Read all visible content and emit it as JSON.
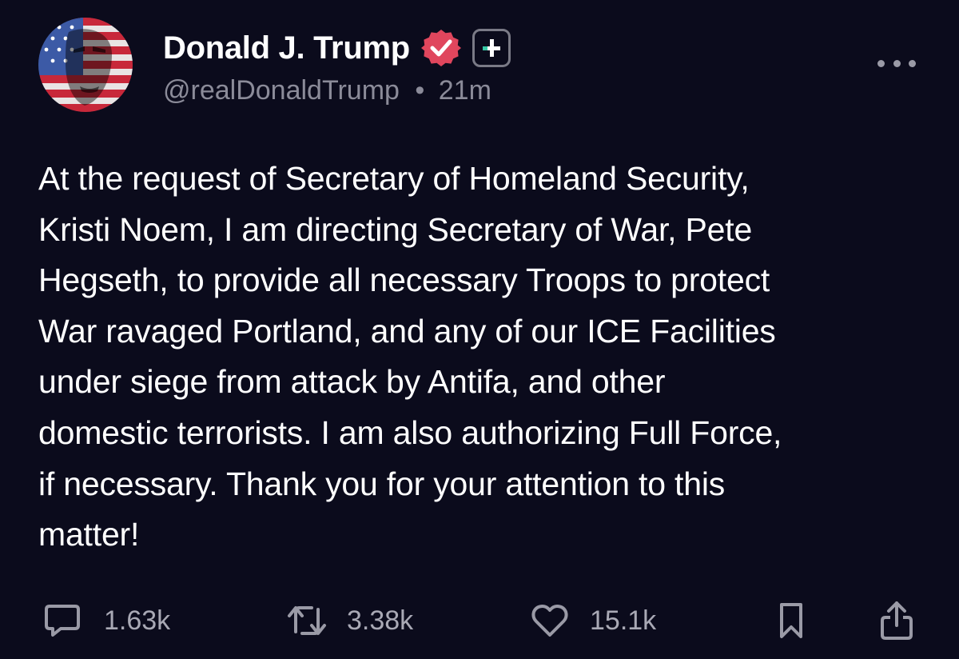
{
  "post": {
    "author": {
      "display_name": "Donald J. Trump",
      "handle": "@realDonaldTrump",
      "separator": "•",
      "time_ago": "21m",
      "avatar_icon": "avatar-flag-face",
      "verified_icon": "verified-badge-icon",
      "plus_icon": "plus-badge-icon"
    },
    "more_icon": "more-options-icon",
    "lines": [
      "At the request of Secretary of Homeland Security,",
      "Kristi Noem, I am directing Secretary of War, Pete",
      "Hegseth, to provide all necessary Troops to protect",
      "War ravaged Portland, and any of our ICE Facilities",
      "under siege from attack by Antifa, and other",
      "domestic terrorists. I am also authorizing Full Force,",
      "if necessary. Thank you for your attention to this",
      "matter!"
    ],
    "actions": {
      "replies": {
        "icon": "reply-icon",
        "count": "1.63k"
      },
      "retruths": {
        "icon": "repost-icon",
        "count": "3.38k"
      },
      "likes": {
        "icon": "heart-icon",
        "count": "15.1k"
      },
      "bookmark": {
        "icon": "bookmark-icon"
      },
      "share": {
        "icon": "share-icon"
      }
    }
  },
  "colors": {
    "background": "#0b0b1c",
    "text": "#ffffff",
    "muted": "#8b8b99",
    "verified": "#e0465d"
  }
}
